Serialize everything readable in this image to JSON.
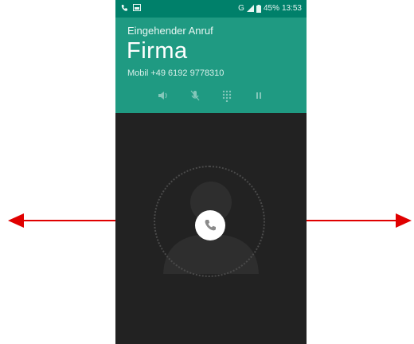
{
  "status": {
    "network": "G",
    "battery": "45%",
    "time": "13:53"
  },
  "call": {
    "label": "Eingehender Anruf",
    "caller": "Firma",
    "number": "Mobil +49 6192 9778310"
  },
  "controls": [
    "speaker-icon",
    "mute-icon",
    "dialpad-icon",
    "hold-icon"
  ],
  "colors": {
    "header": "#1f9a82",
    "statusbar": "#00806a",
    "background": "#222222",
    "arrow": "#e00000"
  }
}
